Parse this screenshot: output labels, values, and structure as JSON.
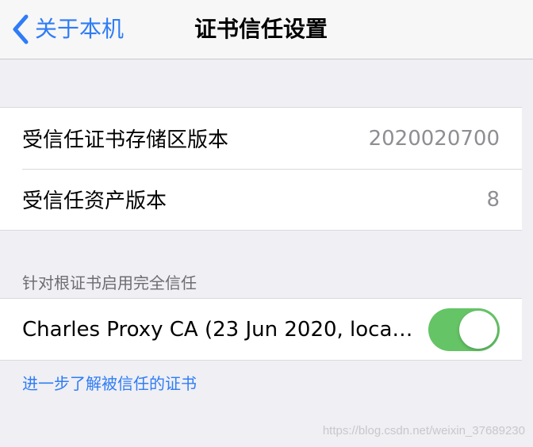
{
  "navbar": {
    "back_label": "关于本机",
    "title": "证书信任设置"
  },
  "versions": {
    "rows": [
      {
        "label": "受信任证书存储区版本",
        "value": "2020020700"
      },
      {
        "label": "受信任资产版本",
        "value": "8"
      }
    ]
  },
  "trust_section": {
    "header": "针对根证书启用完全信任",
    "certificate": {
      "label": "Charles Proxy CA (23 Jun 2020, local...",
      "enabled": true
    }
  },
  "footer": {
    "learn_more": "进一步了解被信任的证书"
  },
  "watermark": "https://blog.csdn.net/weixin_37689230",
  "colors": {
    "accent": "#2f7cf6",
    "toggle_on": "#65c466",
    "background": "#efeff4"
  }
}
